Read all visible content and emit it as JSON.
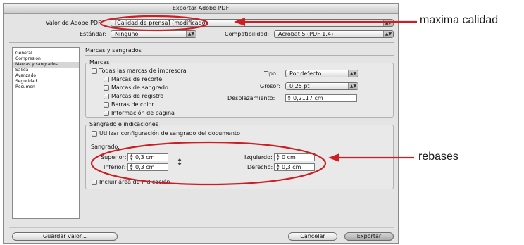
{
  "window": {
    "title": "Exportar Adobe PDF"
  },
  "header": {
    "preset_label": "Valor de Adobe PDF:",
    "preset_value": "[Calidad de prensa] (modificado)",
    "standard_label": "Estándar:",
    "standard_value": "Ninguno",
    "compat_label": "Compatibilidad:",
    "compat_value": "Acrobat 5 (PDF 1.4)"
  },
  "sidebar": {
    "items": [
      {
        "label": "General"
      },
      {
        "label": "Compresión"
      },
      {
        "label": "Marcas y sangrados",
        "selected": true
      },
      {
        "label": "Salida"
      },
      {
        "label": "Avanzado"
      },
      {
        "label": "Seguridad"
      },
      {
        "label": "Resumen"
      }
    ]
  },
  "main": {
    "section_title": "Marcas y sangrados",
    "marks": {
      "legend": "Marcas",
      "all_marks": "Todas las marcas de impresora",
      "crop": "Marcas de recorte",
      "bleed": "Marcas de sangrado",
      "registration": "Marcas de registro",
      "color_bars": "Barras de color",
      "page_info": "Información de página",
      "type_label": "Tipo:",
      "type_value": "Por defecto",
      "weight_label": "Grosor:",
      "weight_value": "0,25 pt",
      "offset_label": "Desplazamiento:",
      "offset_value": "0,2117 cm"
    },
    "bleed": {
      "legend": "Sangrado e indicaciones",
      "use_doc": "Utilizar configuración de sangrado del documento",
      "bleed_label": "Sangrado:",
      "top_label": "Superior:",
      "top_value": "0,3 cm",
      "bottom_label": "Inferior:",
      "bottom_value": "0,3 cm",
      "left_label": "Izquierdo:",
      "left_value": "0 cm",
      "right_label": "Derecho:",
      "right_value": "0,3 cm",
      "slug": "Incluir área de indicación"
    }
  },
  "footer": {
    "save_preset": "Guardar valor...",
    "cancel": "Cancelar",
    "export": "Exportar"
  },
  "annotations": {
    "top_note": "maxima calidad",
    "bleed_note": "rebases",
    "color": "#cc1f24"
  }
}
